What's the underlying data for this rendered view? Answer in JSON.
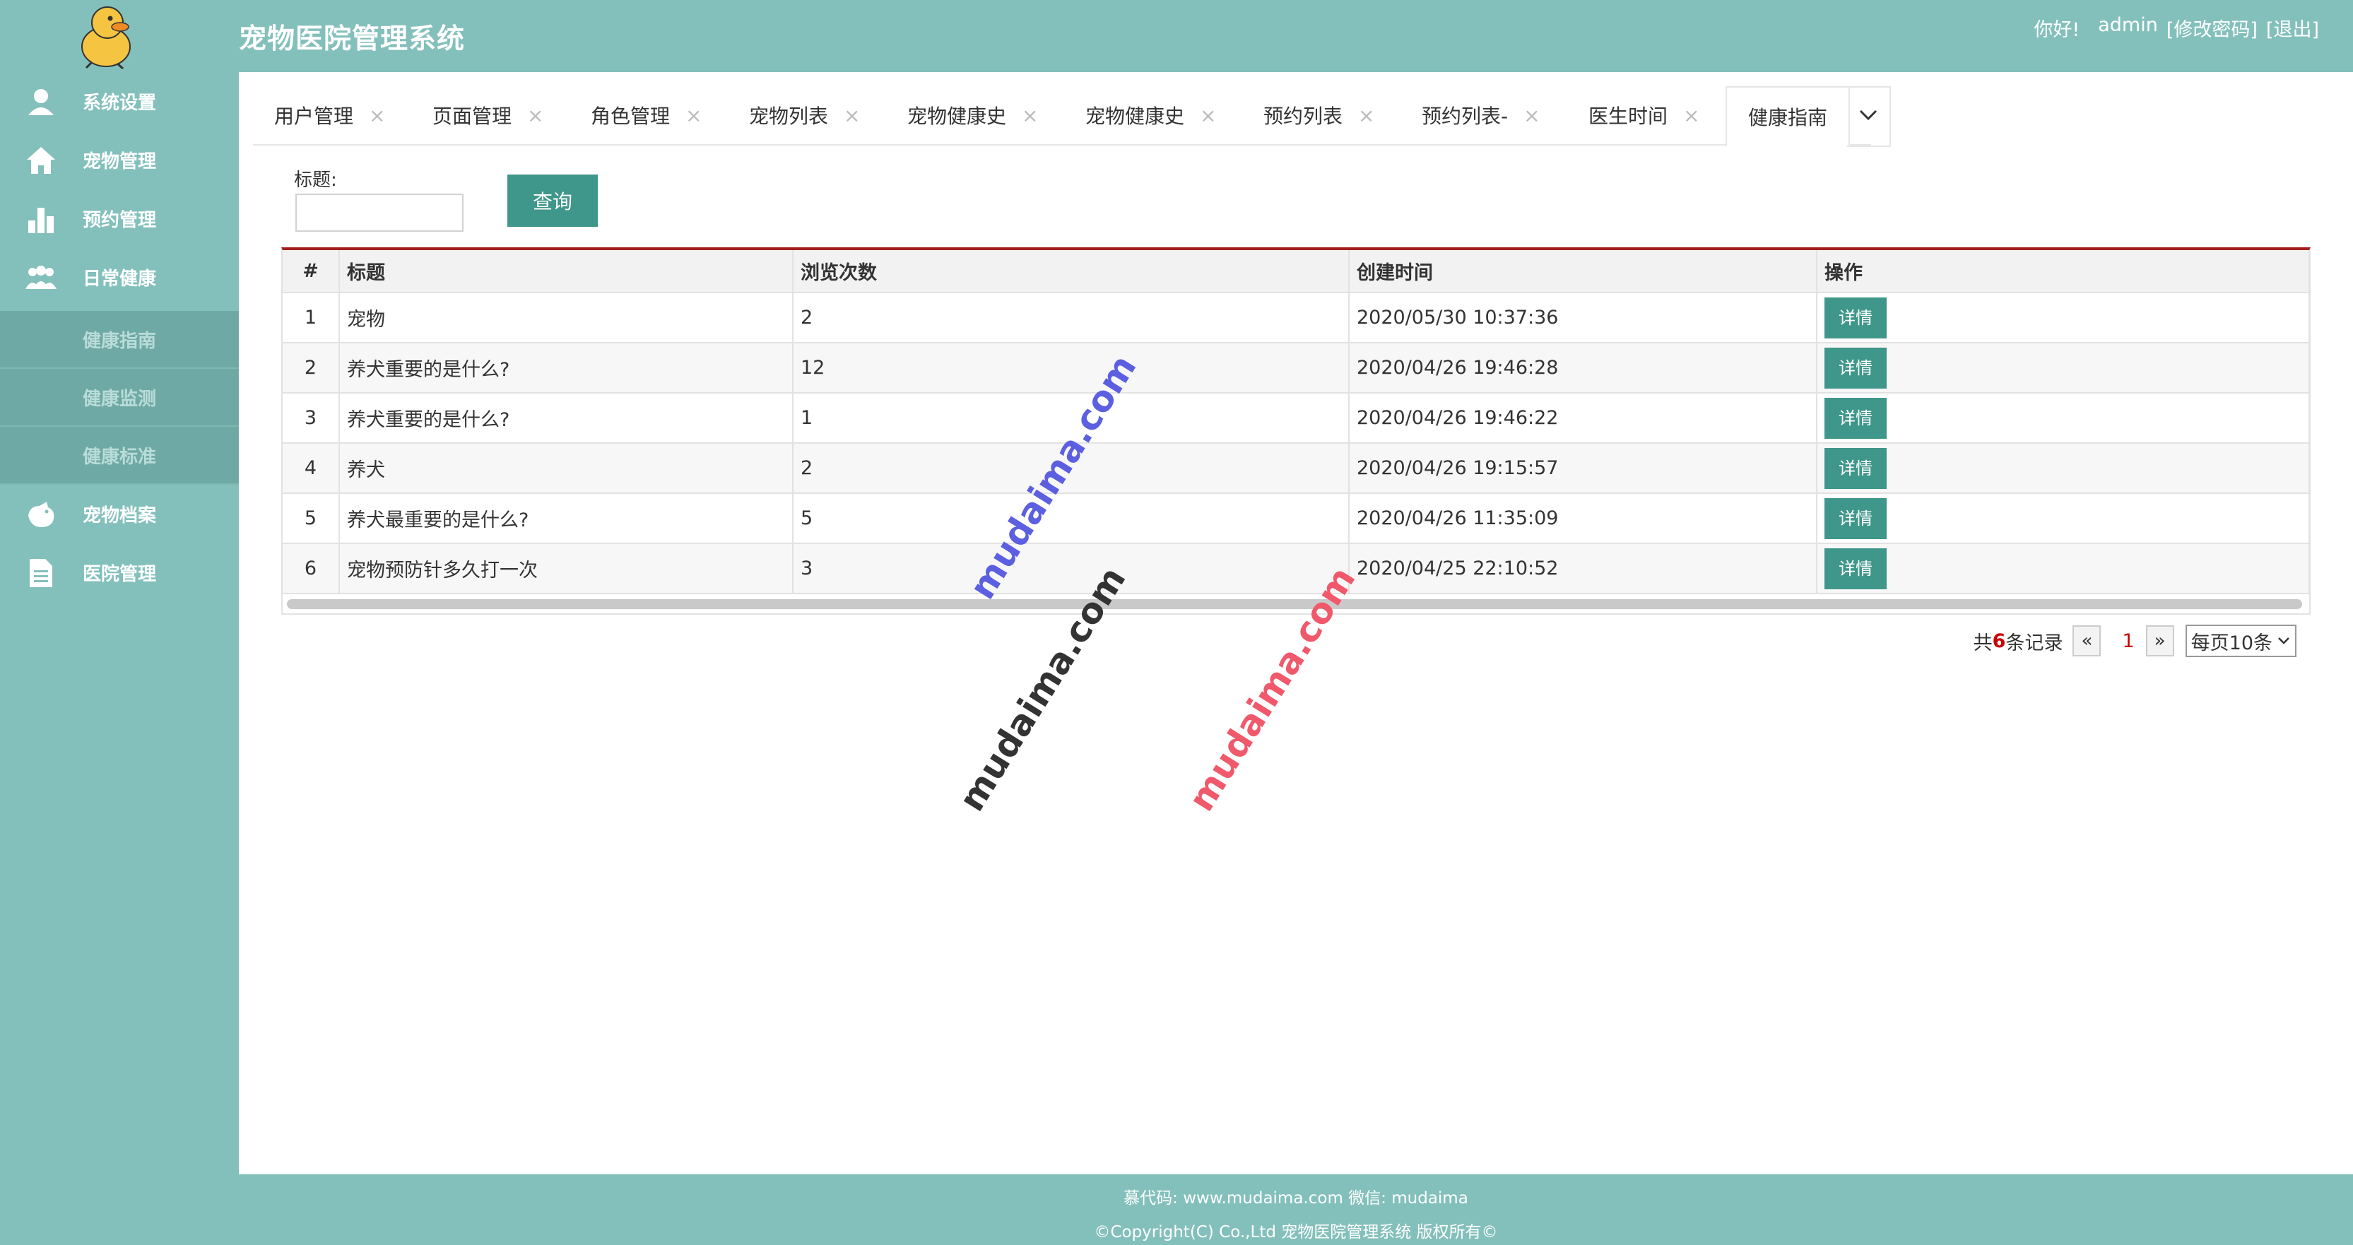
{
  "header": {
    "app_title": "宠物医院管理系统",
    "greeting": "你好!",
    "username": "admin",
    "change_password": "[修改密码]",
    "logout": "[退出]"
  },
  "sidebar": {
    "items": [
      {
        "label": "系统设置",
        "icon": "user-icon"
      },
      {
        "label": "宠物管理",
        "icon": "home-icon"
      },
      {
        "label": "预约管理",
        "icon": "bar-chart-icon"
      },
      {
        "label": "日常健康",
        "icon": "users-icon"
      },
      {
        "label": "宠物档案",
        "icon": "pet-icon"
      },
      {
        "label": "医院管理",
        "icon": "document-icon"
      }
    ],
    "subitems": [
      {
        "label": "健康指南"
      },
      {
        "label": "健康监测"
      },
      {
        "label": "健康标准"
      }
    ]
  },
  "tabs": [
    {
      "label": "用户管理"
    },
    {
      "label": "页面管理"
    },
    {
      "label": "角色管理"
    },
    {
      "label": "宠物列表"
    },
    {
      "label": "宠物健康史"
    },
    {
      "label": "宠物健康史"
    },
    {
      "label": "预约列表"
    },
    {
      "label": "预约列表-"
    },
    {
      "label": "医生时间"
    },
    {
      "label": "健康指南"
    }
  ],
  "search": {
    "label": "标题:",
    "value": "",
    "button": "查询"
  },
  "table": {
    "columns": [
      "#",
      "标题",
      "浏览次数",
      "创建时间",
      "操作"
    ],
    "rows": [
      {
        "num": "1",
        "title": "宠物",
        "views": "2",
        "created": "2020/05/30 10:37:36",
        "action": "详情"
      },
      {
        "num": "2",
        "title": "养犬重要的是什么?",
        "views": "12",
        "created": "2020/04/26 19:46:28",
        "action": "详情"
      },
      {
        "num": "3",
        "title": "养犬重要的是什么?",
        "views": "1",
        "created": "2020/04/26 19:46:22",
        "action": "详情"
      },
      {
        "num": "4",
        "title": "养犬",
        "views": "2",
        "created": "2020/04/26 19:15:57",
        "action": "详情"
      },
      {
        "num": "5",
        "title": "养犬最重要的是什么?",
        "views": "5",
        "created": "2020/04/26 11:35:09",
        "action": "详情"
      },
      {
        "num": "6",
        "title": "宠物预防针多久打一次",
        "views": "3",
        "created": "2020/04/25 22:10:52",
        "action": "详情"
      }
    ]
  },
  "pagination": {
    "prefix": "共",
    "count": "6",
    "suffix": "条记录",
    "prev": "«",
    "current": "1",
    "next": "»",
    "page_size": "每页10条"
  },
  "footer": {
    "line1": "慕代码: www.mudaima.com 微信: mudaima",
    "line2": "©Copyright(C) Co.,Ltd 宠物医院管理系统 版权所有©"
  },
  "watermarks": [
    "mudaima.com",
    "mudaima.com",
    "mudaima.com"
  ],
  "colors": {
    "sidebar_bg": "#83c0bb",
    "button": "#3f968a",
    "table_top_border": "#a51c1c",
    "accent_red": "#cc0000",
    "watermark_blue": "#5b5fe0",
    "watermark_dark": "#333333",
    "watermark_red": "#f0596b"
  }
}
